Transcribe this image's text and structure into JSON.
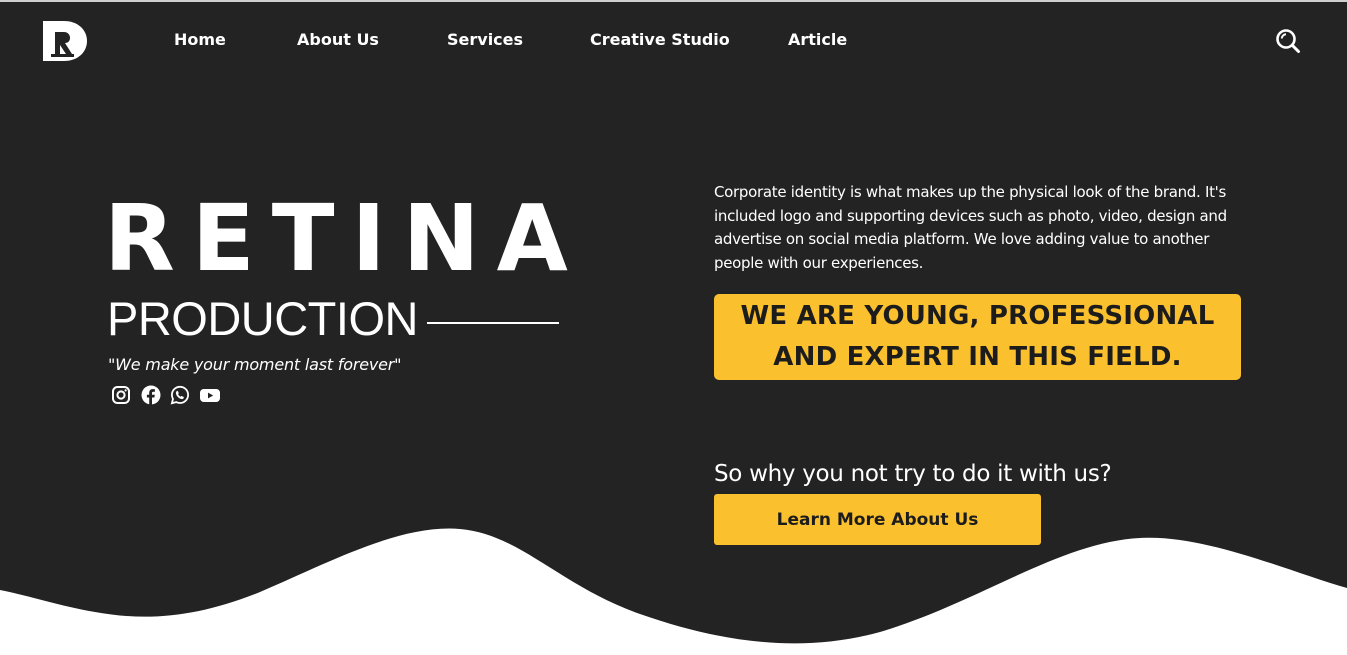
{
  "nav": {
    "items": [
      {
        "label": "Home"
      },
      {
        "label": "About Us"
      },
      {
        "label": "Services"
      },
      {
        "label": "Creative Studio"
      },
      {
        "label": "Article"
      }
    ],
    "search_icon": "search-icon"
  },
  "brand": {
    "title": "RETINA",
    "subtitle": "PRODUCTION",
    "tagline": "\"We make your moment last forever\"",
    "logo_icon": "retina-logo-icon",
    "social_icons": [
      "instagram-icon",
      "facebook-icon",
      "whatsapp-icon",
      "youtube-icon"
    ]
  },
  "intro": {
    "description": "Corporate identity is what makes up the physical look of the brand. It's included logo and supporting devices such as photo, video, design and advertise on social media platform. We love adding value to another people with our experiences.",
    "highlight_line1": "WE ARE YOUNG, PROFESSIONAL",
    "highlight_line2": "AND EXPERT IN THIS FIELD.",
    "question": "So why you not try to do it with us?",
    "cta_label": "Learn More About Us"
  },
  "colors": {
    "background": "#232323",
    "accent": "#fbc02d",
    "text_light": "#ffffff",
    "text_dark": "#1c1c1c",
    "wave": "#ffffff"
  }
}
